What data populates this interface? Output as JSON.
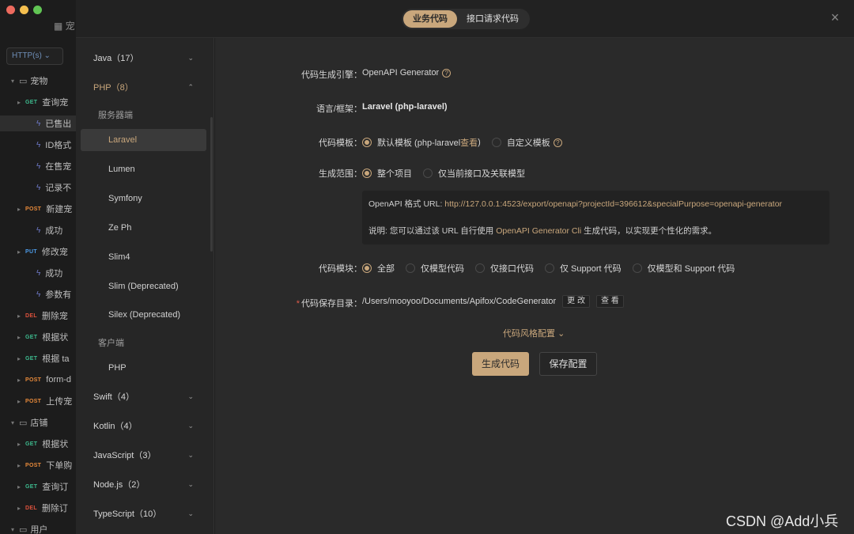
{
  "background": {
    "app_title": "宠",
    "request_type": "HTTP(s)",
    "tree": [
      {
        "kind": "folder",
        "label": "宠物"
      },
      {
        "kind": "api",
        "method": "GET",
        "label": "查询宠"
      },
      {
        "kind": "case",
        "label": "已售出",
        "selected": true
      },
      {
        "kind": "case",
        "label": "ID格式"
      },
      {
        "kind": "case",
        "label": "在售宠"
      },
      {
        "kind": "case",
        "label": "记录不"
      },
      {
        "kind": "api",
        "method": "POST",
        "label": "新建宠"
      },
      {
        "kind": "case",
        "label": "成功"
      },
      {
        "kind": "api",
        "method": "PUT",
        "label": "修改宠"
      },
      {
        "kind": "case",
        "label": "成功"
      },
      {
        "kind": "case",
        "label": "参数有"
      },
      {
        "kind": "api",
        "method": "DEL",
        "label": "删除宠"
      },
      {
        "kind": "api",
        "method": "GET",
        "label": "根据状"
      },
      {
        "kind": "api",
        "method": "GET",
        "label": "根据 ta"
      },
      {
        "kind": "api",
        "method": "POST",
        "label": "form-d"
      },
      {
        "kind": "api",
        "method": "POST",
        "label": "上传宠"
      },
      {
        "kind": "folder",
        "label": "店铺"
      },
      {
        "kind": "api",
        "method": "GET",
        "label": "根据状"
      },
      {
        "kind": "api",
        "method": "POST",
        "label": "下单购"
      },
      {
        "kind": "api",
        "method": "GET",
        "label": "查询订"
      },
      {
        "kind": "api",
        "method": "DEL",
        "label": "删除订"
      },
      {
        "kind": "folder",
        "label": "用户"
      }
    ]
  },
  "header": {
    "tabs": [
      {
        "label": "业务代码",
        "active": true
      },
      {
        "label": "接口请求代码",
        "active": false
      }
    ],
    "close_icon": "×"
  },
  "languages": {
    "java": "Java（17）",
    "php": "PHP（8）",
    "php_server_group": "服务器端",
    "php_server": [
      "Laravel",
      "Lumen",
      "Symfony",
      "Ze Ph",
      "Slim4",
      "Slim (Deprecated)",
      "Silex (Deprecated)"
    ],
    "php_client_group": "客户端",
    "php_client": [
      "PHP"
    ],
    "swift": "Swift（4）",
    "kotlin": "Kotlin（4）",
    "javascript": "JavaScript（3）",
    "nodejs": "Node.js（2）",
    "typescript": "TypeScript（10）",
    "selected": "Laravel"
  },
  "form": {
    "engine_label": "代码生成引擎：",
    "engine_value": "OpenAPI Generator",
    "framework_label": "语言/框架：",
    "framework_value": "Laravel (php-laravel)",
    "template_label": "代码模板：",
    "template_default": "默认模板 (php-laravel ",
    "template_view": "查看",
    "template_default_end": ")",
    "template_custom": "自定义模板",
    "scope_label": "生成范围：",
    "scope_all": "整个项目",
    "scope_current": "仅当前接口及关联模型",
    "info_url_label": "OpenAPI 格式 URL: ",
    "info_url": "http://127.0.0.1:4523/export/openapi?projectId=396612&specialPurpose=openapi-generator",
    "info_desc_pre": "说明: 您可以通过该 URL 自行使用 ",
    "info_desc_link": "OpenAPI Generator Cli",
    "info_desc_post": " 生成代码，以实现更个性化的需求。",
    "module_label": "代码模块：",
    "module_options": [
      "全部",
      "仅模型代码",
      "仅接口代码",
      "仅 Support 代码",
      "仅模型和 Support 代码"
    ],
    "save_dir_label": "代码保存目录：",
    "save_dir_value": "/Users/mooyoo/Documents/Apifox/CodeGenerator",
    "change_btn": "更 改",
    "view_btn": "查 看",
    "style_config": "代码风格配置",
    "generate_btn": "生成代码",
    "save_btn": "保存配置"
  },
  "watermark": "CSDN @Add小兵"
}
